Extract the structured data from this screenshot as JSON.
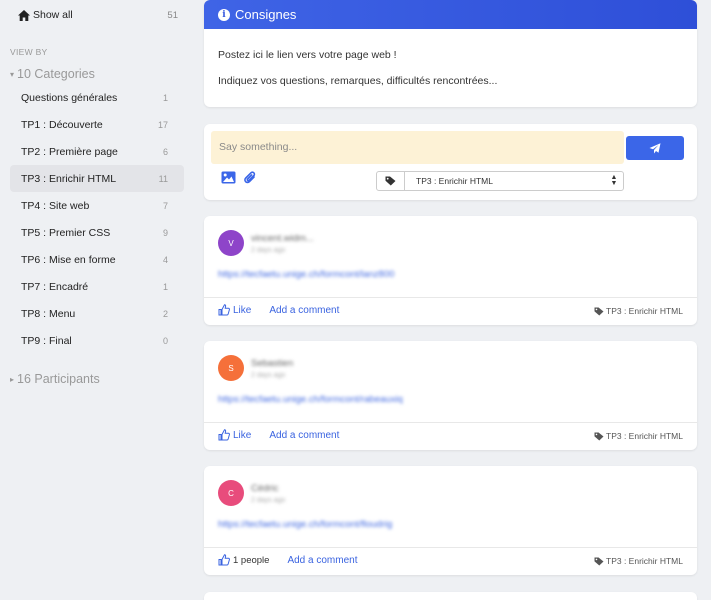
{
  "sidebar": {
    "show_all": {
      "label": "Show all",
      "count": "51",
      "icon": "home-icon"
    },
    "view_by": "VIEW BY",
    "categories_header": "10 Categories",
    "categories": [
      {
        "label": "Questions générales",
        "count": "1"
      },
      {
        "label": "TP1 : Découverte",
        "count": "17"
      },
      {
        "label": "TP2 : Première page",
        "count": "6"
      },
      {
        "label": "TP3 : Enrichir HTML",
        "count": "11",
        "active": true
      },
      {
        "label": "TP4 : Site web",
        "count": "7"
      },
      {
        "label": "TP5 : Premier CSS",
        "count": "9"
      },
      {
        "label": "TP6 : Mise en forme",
        "count": "4"
      },
      {
        "label": "TP7 : Encadré",
        "count": "1"
      },
      {
        "label": "TP8 : Menu",
        "count": "2"
      },
      {
        "label": "TP9 : Final",
        "count": "0"
      }
    ],
    "participants_header": "16 Participants"
  },
  "consignes": {
    "title": "Consignes",
    "lines": [
      "Postez ici le lien vers votre page web !",
      "Indiquez vos questions, remarques, difficultés rencontrées..."
    ]
  },
  "composer": {
    "placeholder": "Say something...",
    "selected_tag": "TP3 : Enrichir HTML",
    "icons": [
      "image-icon",
      "paperclip-icon",
      "send-icon",
      "tag-icon"
    ]
  },
  "posts": [
    {
      "author": "vincent.widm...",
      "time": "2 days ago",
      "avatar_letter": "V",
      "avatar_color": "#8e44c9",
      "link": "https://tecfaetu.unige.ch/formcont/lanz800",
      "like_label": "Like",
      "comment_label": "Add a comment",
      "tag": "TP3 : Enrichir HTML"
    },
    {
      "author": "Sebastien",
      "time": "2 days ago",
      "avatar_letter": "S",
      "avatar_color": "#f5703a",
      "link": "https://tecfaetu.unige.ch/formcont/rabeauxiq",
      "like_label": "Like",
      "comment_label": "Add a comment",
      "tag": "TP3 : Enrichir HTML"
    },
    {
      "author": "Cédric",
      "time": "2 days ago",
      "avatar_letter": "C",
      "avatar_color": "#e84c7c",
      "link": "https://tecfaetu.unige.ch/formcont/floudrig",
      "like_label": "1 people",
      "comment_label": "Add a comment",
      "tag": "TP3 : Enrichir HTML"
    }
  ],
  "colors": {
    "accent": "#3b66e8",
    "composer_bg": "#fdf2d6",
    "active_bg": "#e3e4e8"
  }
}
